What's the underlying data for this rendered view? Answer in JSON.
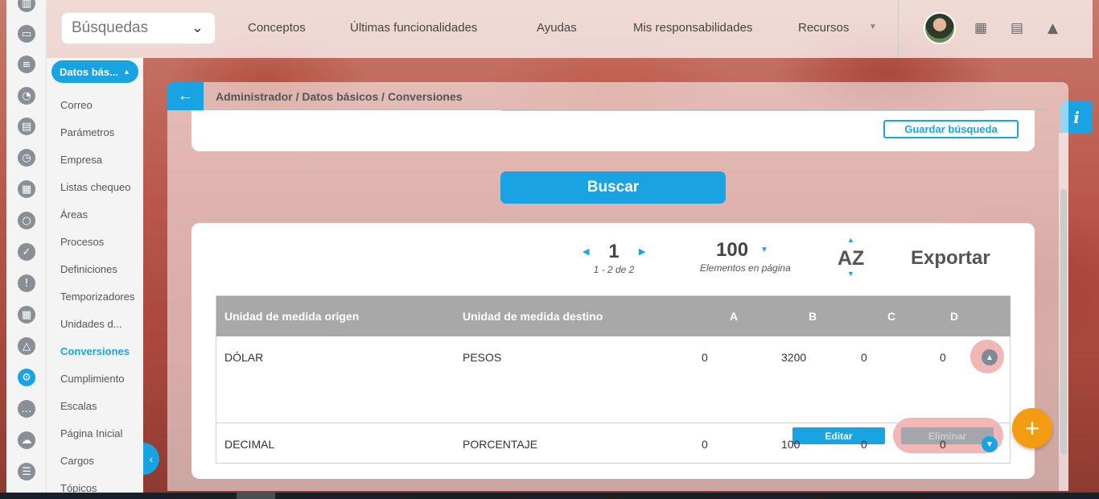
{
  "topbar": {
    "search_label": "Búsquedas",
    "nav": [
      "Conceptos",
      "Últimas funcionalidades",
      "Ayudas",
      "Mis responsabilidades",
      "Recursos"
    ]
  },
  "rail": {
    "icons": [
      "chart-icon",
      "presentation-icon",
      "gantt-icon",
      "pie-icon",
      "map-icon",
      "clock-icon",
      "document-icon",
      "cycle-icon",
      "check-icon",
      "warning-icon",
      "calendar-icon",
      "network-icon",
      "gear-icon",
      "chat-icon",
      "cloud-icon",
      "list-icon"
    ]
  },
  "menu": {
    "section_label": "Datos bás...",
    "items": [
      "Correo",
      "Parámetros",
      "Empresa",
      "Listas chequeo",
      "Áreas",
      "Procesos",
      "Definiciones",
      "Temporizadores",
      "Unidades d...",
      "Conversiones",
      "Cumplimiento",
      "Escalas",
      "Página Inicial",
      "Cargos",
      "Tópicos"
    ],
    "active": "Conversiones"
  },
  "panel": {
    "breadcrumb": "Administrador / Datos básicos / Conversiones",
    "save_search_label": "Guardar búsqueda",
    "search_button_label": "Buscar"
  },
  "pager": {
    "page": "1",
    "range": "1 - 2 de 2",
    "per_page": "100",
    "per_page_label": "Elementos en página",
    "sort_label": "AZ",
    "export_label": "Exportar"
  },
  "table": {
    "headers": [
      "Unidad de medida origen",
      "Unidad de medida destino",
      "A",
      "B",
      "C",
      "D"
    ],
    "rows": [
      {
        "origen": "DÓLAR",
        "destino": "PESOS",
        "a": "0",
        "b": "3200",
        "c": "0",
        "d": "0",
        "expanded": true
      },
      {
        "origen": "DECIMAL",
        "destino": "PORCENTAJE",
        "a": "0",
        "b": "100",
        "c": "0",
        "d": "0",
        "expanded": false
      }
    ],
    "edit_label": "Editar",
    "delete_label": "Eliminar"
  },
  "info_label": "i",
  "colors": {
    "accent": "#1aa3e3",
    "fab": "#f39c12",
    "header_gray": "#a8a8a8"
  }
}
